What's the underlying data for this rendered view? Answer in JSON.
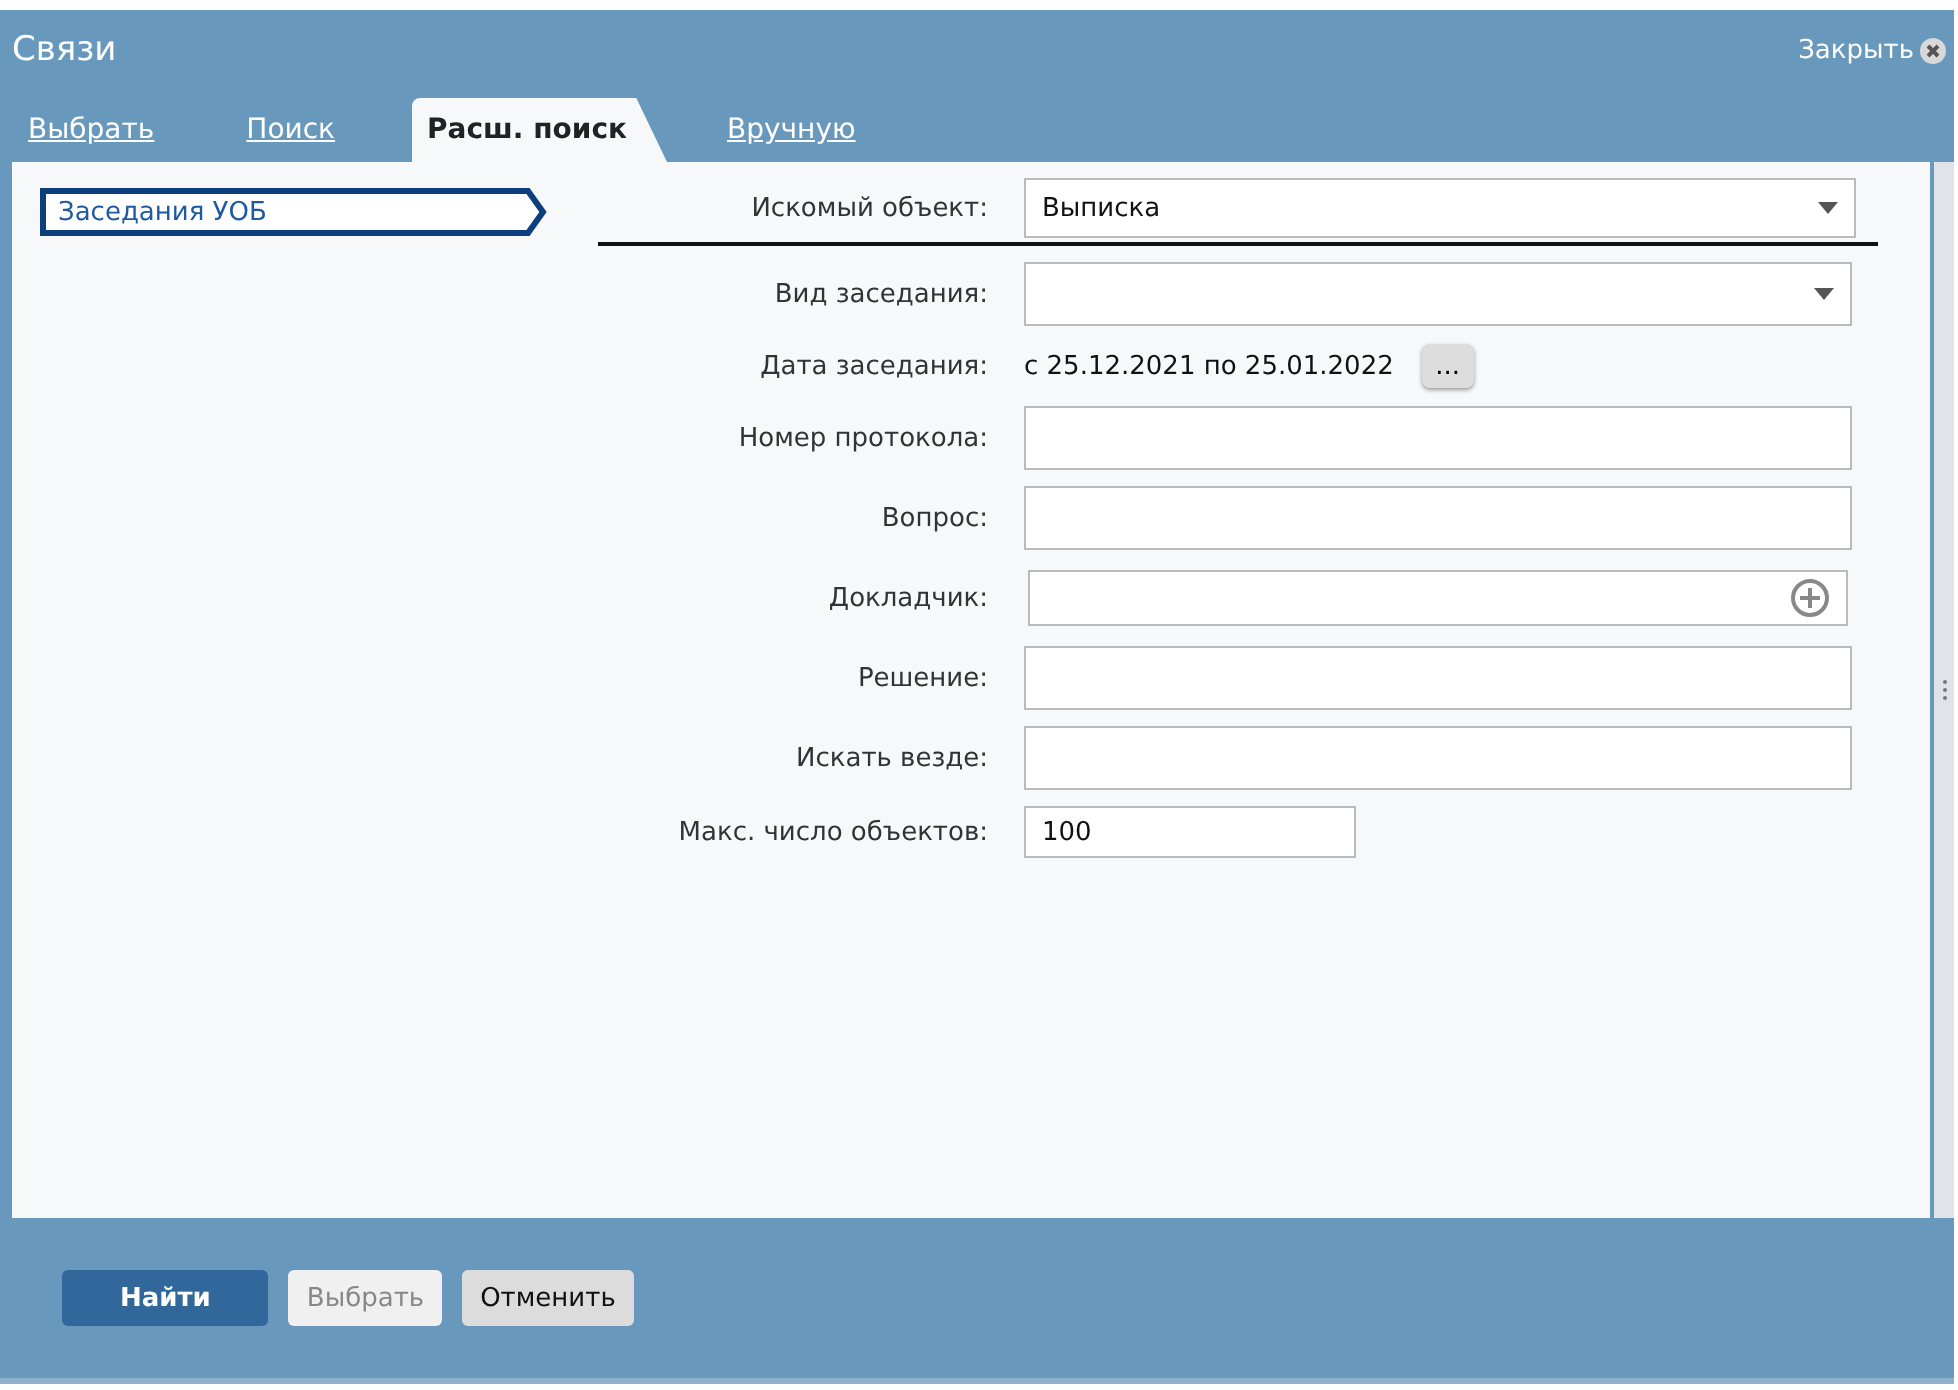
{
  "window": {
    "title": "Связи",
    "close_label": "Закрыть"
  },
  "tabs": [
    {
      "label": "Выбрать",
      "selected": false
    },
    {
      "label": "Поиск",
      "selected": false
    },
    {
      "label": "Расш. поиск",
      "selected": true
    },
    {
      "label": "Вручную",
      "selected": false
    }
  ],
  "sidebar": {
    "items": [
      {
        "label": "Заседания УОБ",
        "selected": true
      }
    ]
  },
  "form": {
    "fields": [
      {
        "kind": "select",
        "label": "Искомый объект:",
        "value": "Выписка"
      },
      {
        "kind": "select",
        "label": "Вид заседания:"
      },
      {
        "kind": "daterange",
        "label": "Дата заседания:",
        "value": "с 25.12.2021 по 25.01.2022",
        "button": "..."
      },
      {
        "kind": "text",
        "label": "Номер протокола:"
      },
      {
        "kind": "text",
        "label": "Вопрос:"
      },
      {
        "kind": "picker",
        "label": "Докладчик:"
      },
      {
        "kind": "text",
        "label": "Решение:"
      },
      {
        "kind": "text",
        "label": "Искать везде:"
      },
      {
        "kind": "number",
        "label": "Макс. число объектов:",
        "value": "100"
      }
    ]
  },
  "buttons": [
    {
      "label": "Найти",
      "kind": "primary",
      "disabled": false
    },
    {
      "label": "Выбрать",
      "kind": "plain",
      "disabled": true
    },
    {
      "label": "Отменить",
      "kind": "plain",
      "disabled": false
    }
  ]
}
